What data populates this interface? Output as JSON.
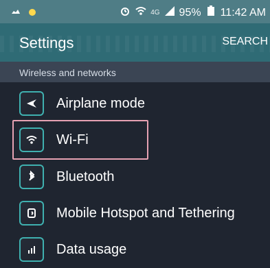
{
  "status_bar": {
    "icons": [
      "message-icon",
      "android-icon",
      "alarm-icon",
      "wifi-icon",
      "signal-icon",
      "battery-icon"
    ],
    "signal_label": "4G",
    "battery_text": "95%",
    "time_text": "11:42 AM"
  },
  "app_bar": {
    "title": "Settings",
    "search_label": "SEARCH"
  },
  "section": {
    "title": "Wireless and networks"
  },
  "settings_items": [
    {
      "label": "Airplane mode",
      "icon": "airplane-icon"
    },
    {
      "label": "Wi-Fi",
      "icon": "wifi-icon"
    },
    {
      "label": "Bluetooth",
      "icon": "bluetooth-icon"
    },
    {
      "label": "Mobile Hotspot and Tethering",
      "icon": "hotspot-icon"
    },
    {
      "label": "Data usage",
      "icon": "data-usage-icon"
    }
  ],
  "colors": {
    "status_bar": "#4f7d86",
    "app_bar": "#2f6b75",
    "section_header": "#3b4554",
    "list_bg": "#1f2530",
    "icon_accent": "#3fb1b0",
    "highlight": "#e7a2b3"
  }
}
